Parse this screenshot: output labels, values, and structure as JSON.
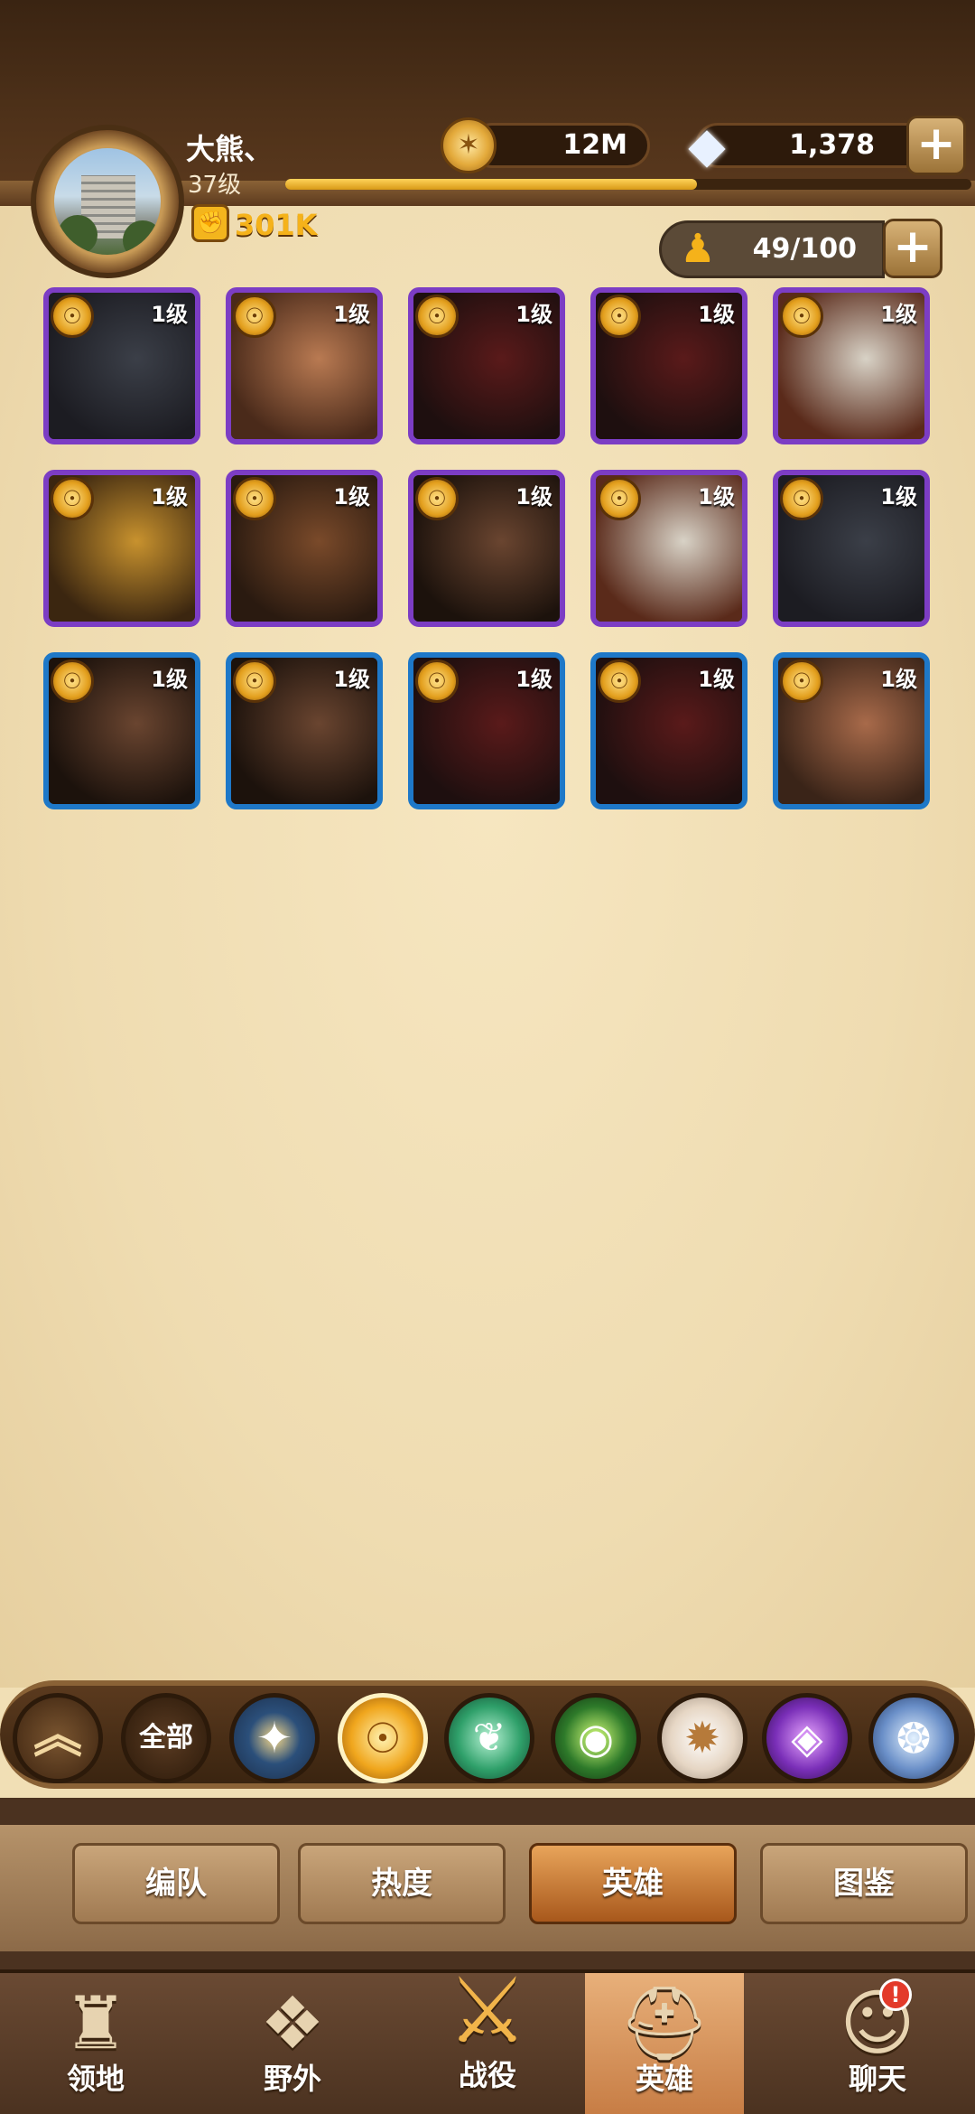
{
  "player": {
    "name": "大熊、",
    "level": "37级",
    "xp_progress": 0.6,
    "power": "301K"
  },
  "resources": {
    "gold": "12M",
    "gems": "1,378",
    "roster": "49/100"
  },
  "heroes": [
    {
      "level": "1级",
      "rarity": "purple"
    },
    {
      "level": "1级",
      "rarity": "purple"
    },
    {
      "level": "1级",
      "rarity": "purple"
    },
    {
      "level": "1级",
      "rarity": "purple"
    },
    {
      "level": "1级",
      "rarity": "purple"
    },
    {
      "level": "1级",
      "rarity": "purple"
    },
    {
      "level": "1级",
      "rarity": "purple"
    },
    {
      "level": "1级",
      "rarity": "purple"
    },
    {
      "level": "1级",
      "rarity": "purple"
    },
    {
      "level": "1级",
      "rarity": "purple"
    },
    {
      "level": "1级",
      "rarity": "blue"
    },
    {
      "level": "1级",
      "rarity": "blue"
    },
    {
      "level": "1级",
      "rarity": "blue"
    },
    {
      "level": "1级",
      "rarity": "blue"
    },
    {
      "level": "1级",
      "rarity": "blue"
    }
  ],
  "filters": {
    "all_label": "全部"
  },
  "tabs": [
    {
      "label": "编队"
    },
    {
      "label": "热度"
    },
    {
      "label": "英雄"
    },
    {
      "label": "图鉴"
    }
  ],
  "nav": [
    {
      "label": "领地"
    },
    {
      "label": "野外"
    },
    {
      "label": "战役"
    },
    {
      "label": "英雄"
    },
    {
      "label": "聊天"
    }
  ],
  "chat_badge": "!"
}
